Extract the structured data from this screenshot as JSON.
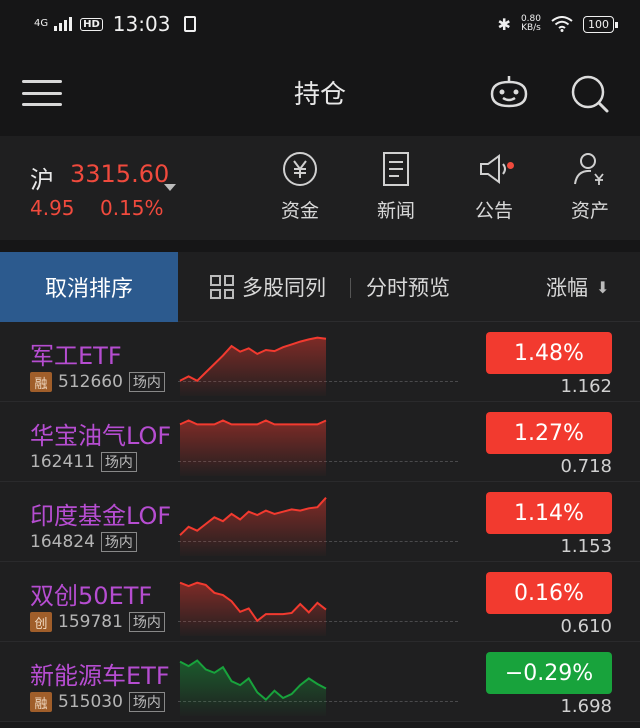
{
  "status": {
    "network": "4G",
    "hd": "HD",
    "time": "13:03",
    "speed_value": "0.80",
    "speed_unit": "KB/s",
    "battery": "100"
  },
  "nav": {
    "title": "持仓"
  },
  "index": {
    "name": "沪",
    "value": "3315.60",
    "change": "4.95",
    "change_pct": "0.15%",
    "quick_links": [
      {
        "label": "资金",
        "icon": "yen-circle-icon"
      },
      {
        "label": "新闻",
        "icon": "document-icon"
      },
      {
        "label": "公告",
        "icon": "speaker-icon"
      },
      {
        "label": "资产",
        "icon": "person-yen-icon"
      }
    ]
  },
  "tabs": {
    "cancel_sort": "取消排序",
    "multi_stock": "多股同列",
    "timeshare": "分时预览",
    "change": "涨幅",
    "sort_arrow": "⬇"
  },
  "rows": [
    {
      "name": "军工ETF",
      "tag": "融",
      "code": "512660",
      "market": "场内",
      "change": "1.48%",
      "price": "1.162",
      "direction": "up",
      "spark": [
        0.2,
        0.28,
        0.2,
        0.35,
        0.5,
        0.65,
        0.82,
        0.72,
        0.78,
        0.68,
        0.75,
        0.73,
        0.8,
        0.85,
        0.9,
        0.94,
        0.97,
        0.95
      ]
    },
    {
      "name": "华宝油气LOF",
      "tag": "",
      "code": "162411",
      "market": "场内",
      "change": "1.27%",
      "price": "0.718",
      "direction": "up",
      "spark": [
        0.85,
        0.92,
        0.85,
        0.85,
        0.85,
        0.92,
        0.85,
        0.85,
        0.85,
        0.85,
        0.92,
        0.85,
        0.85,
        0.85,
        0.85,
        0.85,
        0.85,
        0.92
      ]
    },
    {
      "name": "印度基金LOF",
      "tag": "",
      "code": "164824",
      "market": "场内",
      "change": "1.14%",
      "price": "1.153",
      "direction": "up",
      "spark": [
        0.3,
        0.45,
        0.38,
        0.5,
        0.62,
        0.55,
        0.68,
        0.58,
        0.72,
        0.66,
        0.74,
        0.68,
        0.72,
        0.76,
        0.74,
        0.78,
        0.8,
        0.97
      ]
    },
    {
      "name": "双创50ETF",
      "tag": "创",
      "code": "159781",
      "market": "场内",
      "change": "0.16%",
      "price": "0.610",
      "direction": "up",
      "spark": [
        0.88,
        0.82,
        0.88,
        0.84,
        0.7,
        0.66,
        0.55,
        0.36,
        0.42,
        0.2,
        0.32,
        0.32,
        0.32,
        0.34,
        0.5,
        0.35,
        0.52,
        0.4
      ]
    },
    {
      "name": "新能源车ETF",
      "tag": "融",
      "code": "515030",
      "market": "场内",
      "change": "−0.29%",
      "price": "1.698",
      "direction": "down",
      "spark": [
        0.9,
        0.82,
        0.92,
        0.76,
        0.7,
        0.8,
        0.55,
        0.48,
        0.6,
        0.35,
        0.22,
        0.38,
        0.25,
        0.32,
        0.48,
        0.6,
        0.5,
        0.42
      ]
    }
  ],
  "colors": {
    "up": "#f23a2f",
    "down": "#18a33c",
    "accent": "#2c5a8e",
    "name": "#b64dd1"
  }
}
